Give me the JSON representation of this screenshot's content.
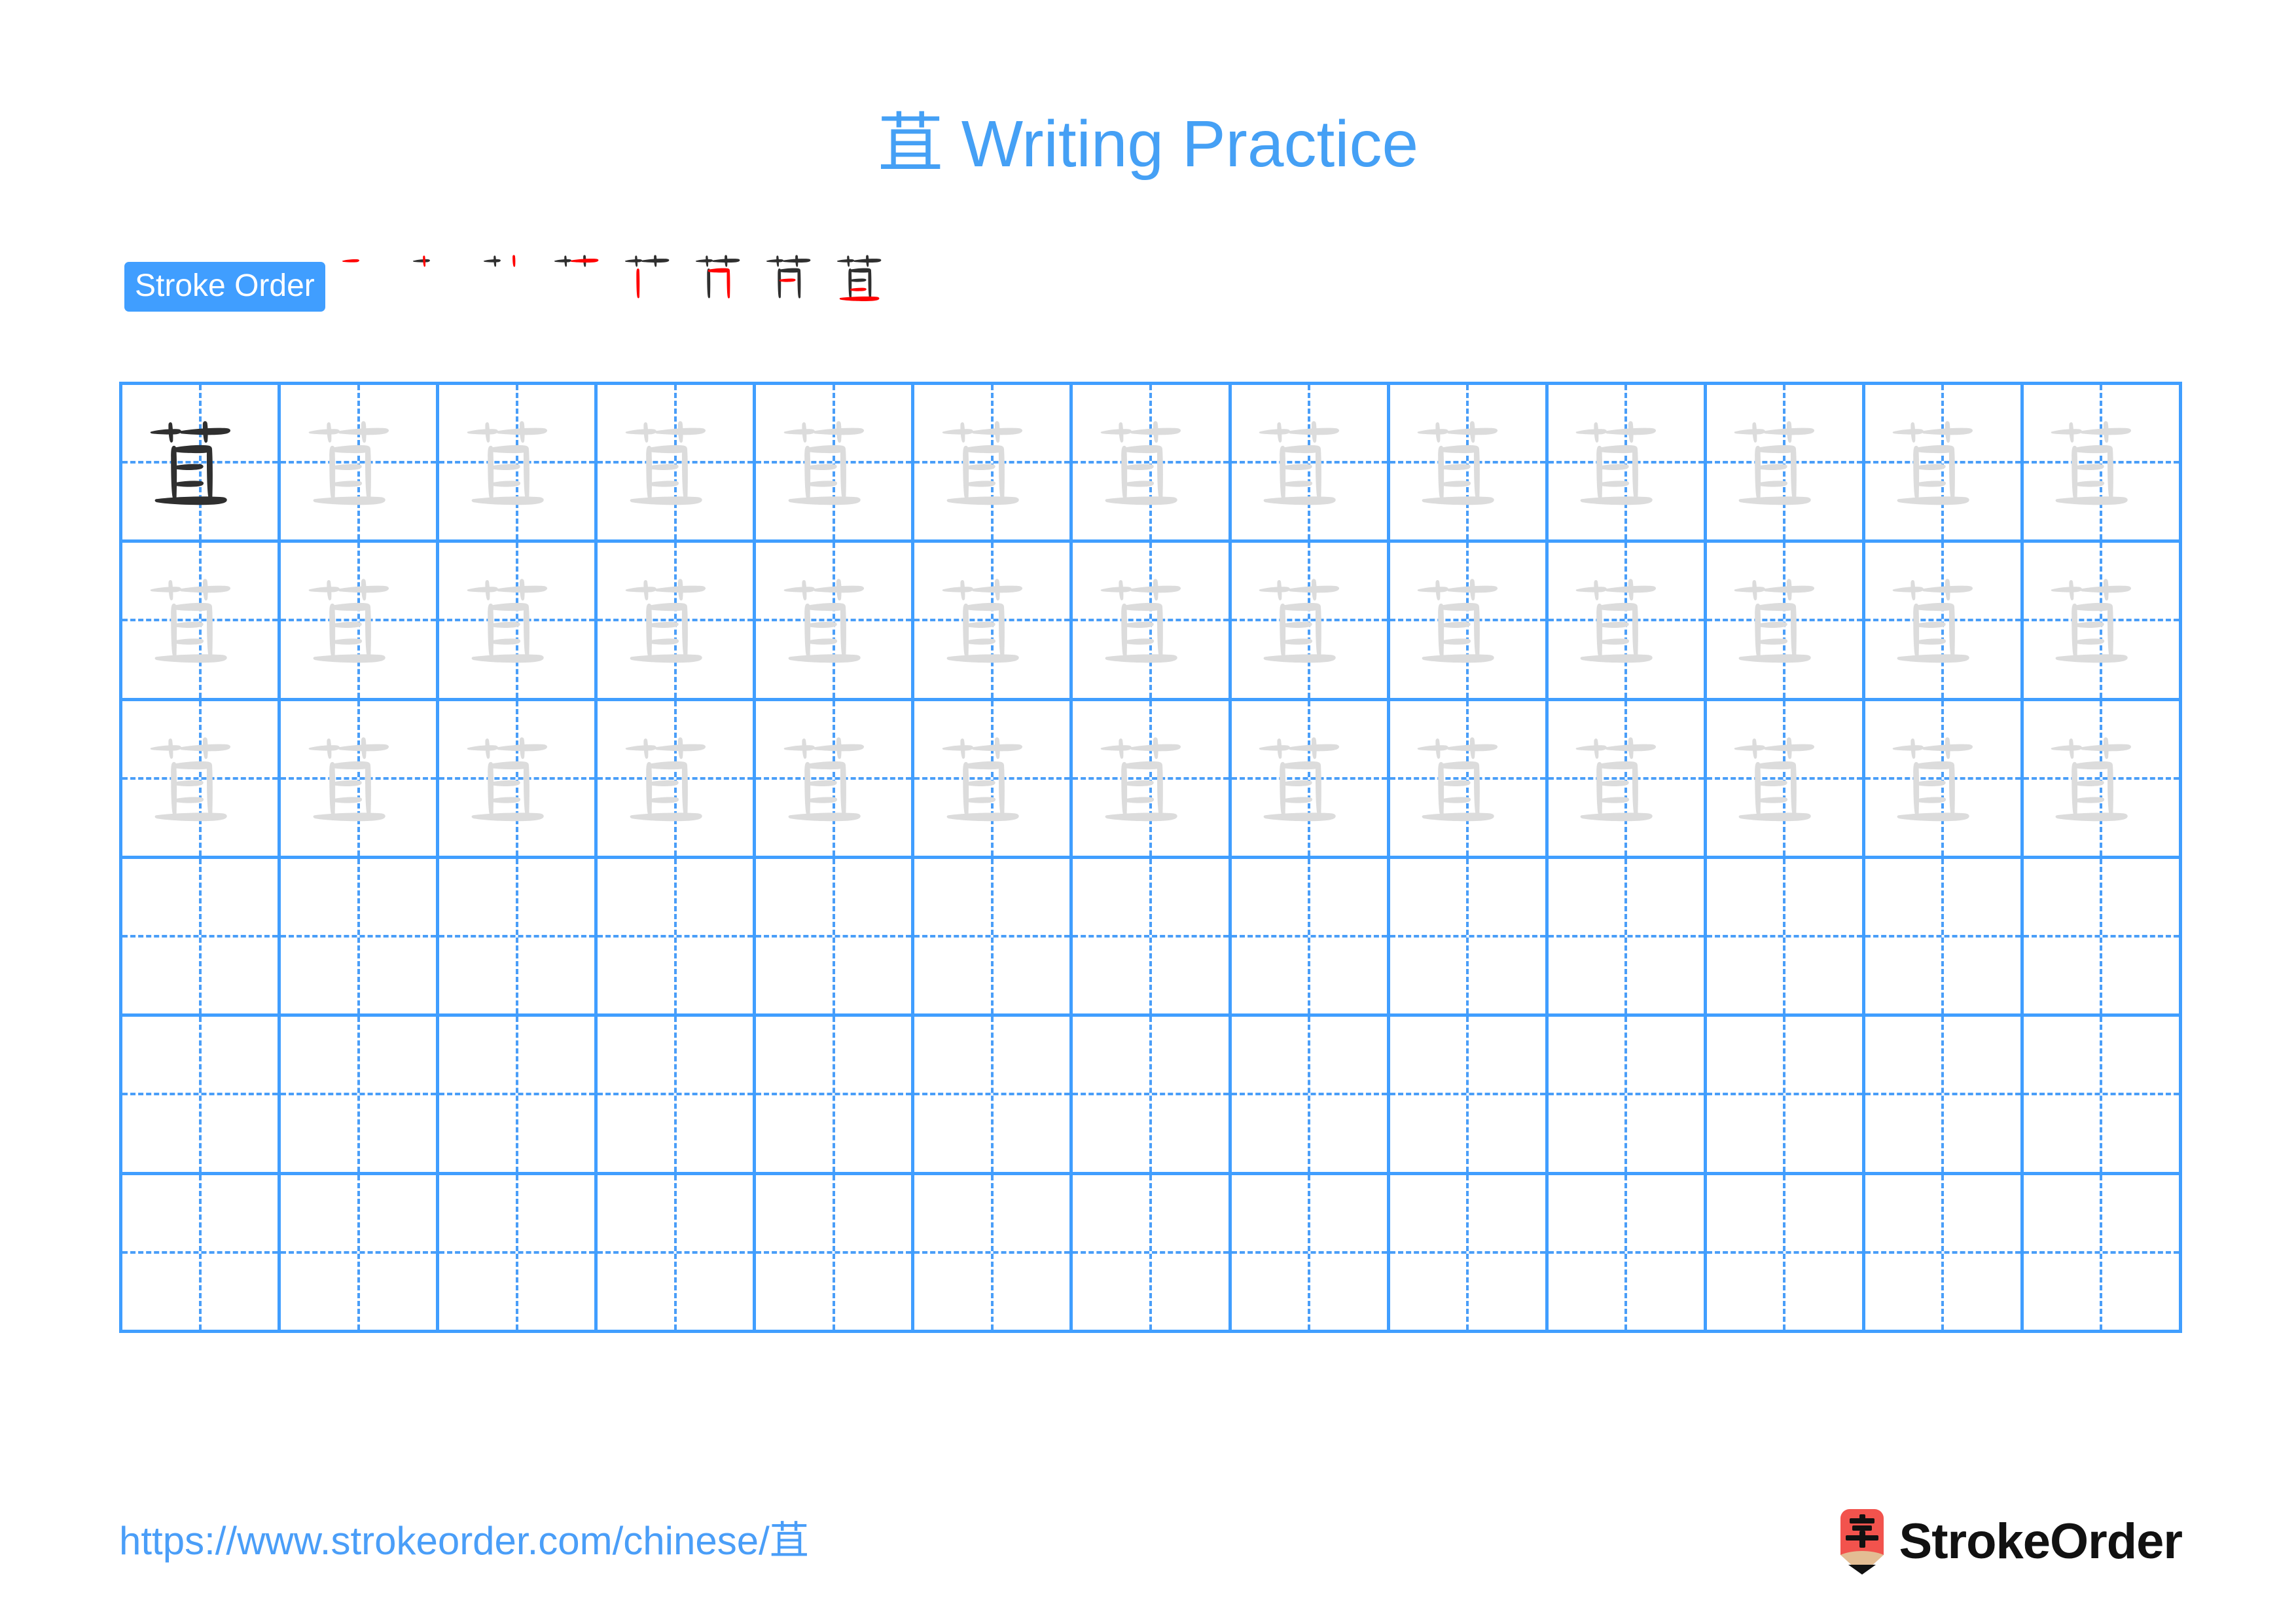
{
  "character": "苴",
  "title": "苴 Writing Practice",
  "colors": {
    "accent_blue": "#409eff",
    "title_blue": "#45a0f5",
    "grid_line": "#409eff",
    "guide_line": "#4a9ef8",
    "trace_gray": "#dcdcdc",
    "ink_black": "#2f2f2f",
    "new_stroke_red": "#ff0000",
    "logo_red": "#f2534d",
    "logo_wood": "#e3bd93"
  },
  "stroke_order": {
    "badge_label": "Stroke Order",
    "stroke_count": 8,
    "steps": [
      {
        "index": 1,
        "strokes_shown": 1,
        "new_stroke": 1
      },
      {
        "index": 2,
        "strokes_shown": 2,
        "new_stroke": 2
      },
      {
        "index": 3,
        "strokes_shown": 3,
        "new_stroke": 3
      },
      {
        "index": 4,
        "strokes_shown": 4,
        "new_stroke": 4
      },
      {
        "index": 5,
        "strokes_shown": 5,
        "new_stroke": 5
      },
      {
        "index": 6,
        "strokes_shown": 6,
        "new_stroke": 6
      },
      {
        "index": 7,
        "strokes_shown": 7,
        "new_stroke": 7
      },
      {
        "index": 8,
        "strokes_shown": 8,
        "new_stroke": 8
      }
    ]
  },
  "grid": {
    "columns": 13,
    "rows": 6,
    "cells": [
      [
        "ink",
        "trace",
        "trace",
        "trace",
        "trace",
        "trace",
        "trace",
        "trace",
        "trace",
        "trace",
        "trace",
        "trace",
        "trace"
      ],
      [
        "trace",
        "trace",
        "trace",
        "trace",
        "trace",
        "trace",
        "trace",
        "trace",
        "trace",
        "trace",
        "trace",
        "trace",
        "trace"
      ],
      [
        "trace",
        "trace",
        "trace",
        "trace",
        "trace",
        "trace",
        "trace",
        "trace",
        "trace",
        "trace",
        "trace",
        "trace",
        "trace"
      ],
      [
        "empty",
        "empty",
        "empty",
        "empty",
        "empty",
        "empty",
        "empty",
        "empty",
        "empty",
        "empty",
        "empty",
        "empty",
        "empty"
      ],
      [
        "empty",
        "empty",
        "empty",
        "empty",
        "empty",
        "empty",
        "empty",
        "empty",
        "empty",
        "empty",
        "empty",
        "empty",
        "empty"
      ],
      [
        "empty",
        "empty",
        "empty",
        "empty",
        "empty",
        "empty",
        "empty",
        "empty",
        "empty",
        "empty",
        "empty",
        "empty",
        "empty"
      ]
    ]
  },
  "footer": {
    "url": "https://www.strokeorder.com/chinese/苴",
    "logo_text": "StrokeOrder",
    "logo_glyph": "字"
  }
}
